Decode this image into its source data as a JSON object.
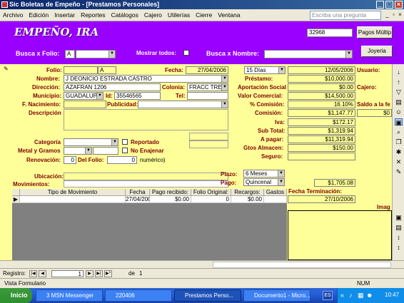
{
  "window": {
    "title": "Sic Boletas de Empeño - [Prestamos Personales]"
  },
  "menu": [
    "Archivo",
    "Edición",
    "Insertar",
    "Reportes",
    "Catálogos",
    "Cajero",
    "Utilerías",
    "Cierre",
    "Ventana"
  ],
  "help_placeholder": "Escriba una pregunta",
  "header": {
    "logo": "EMPEÑO, IRA",
    "number": "32968",
    "btn_pagos": "Pagos Múltip",
    "btn_joyeria": "Joyeria",
    "busca_folio_label": "Busca x Folio:",
    "busca_folio_value": "A",
    "mostrar_todos_label": "Mostrar todos:",
    "busca_nombre_label": "Busca x Nombre:"
  },
  "form": {
    "folio_label": "Folio:",
    "folio_prefix": "A",
    "fecha_label": "Fecha:",
    "fecha_value": "27/04/2006",
    "plazo_dias": "15 Días",
    "fecha2_value": "12/05/2006",
    "usuario_label": "Usuario:",
    "nombre_label": "Nombre:",
    "nombre_value": "J DEONICIO ESTRADA CASTRO",
    "direccion_label": "Dirección:",
    "direccion_value": "AZAFRAN 1206",
    "colonia_label": "Colonia:",
    "colonia_value": "FRACC TRES",
    "municipio_label": "Municipio:",
    "municipio_value": "GUADALUPE",
    "id_label": "Id:",
    "id_value": "35546565",
    "tel_label": "Tel:",
    "nacimiento_label": "F. Nacimiento:",
    "publicidad_label": "Publicidad:",
    "descripcion_label": "Descripción",
    "categoria_label": "Categoría",
    "reportado_label": "Reportado",
    "metal_label": "Metal y Gramos",
    "no_enajenar_label": "No Enajenar",
    "renovacion_label": "Renovación:",
    "renovacion_value": "0",
    "delfolio_label": "Del Folio:",
    "delfolio_value": "0",
    "numerico": "numérico)",
    "ubicacion_label": "Ubicación:",
    "movimientos_label": "Movimientos:",
    "plazo_label": "Plazo:",
    "plazo_value": "6 Meses",
    "pago_label": "Pago:",
    "pago_value": "Quincenal",
    "fecha_terminacion_label": "Fecha Terminación:",
    "fecha_terminacion_value": "27/10/2006",
    "extra_amount": "$1,705.08",
    "imagen_label": "Imag"
  },
  "money": {
    "prestamo_label": "Préstamo:",
    "prestamo": "$10,000.00",
    "aportacion_label": "Aportación Social",
    "aportacion": "$0.00",
    "cajero_label": "Cajero:",
    "valor_label": "Valor Comercial:",
    "valor": "$14,500.00",
    "comision_pct_label": "% Comisión:",
    "comision_pct": "16.10%",
    "saldo_label": "Saldo a la fe",
    "comision_label": "Comisión:",
    "comision": "$1,147.77",
    "saldo_partial": "$0",
    "iva_label": "Iva:",
    "iva": "$172.17",
    "subtotal_label": "Sub Total:",
    "subtotal": "$1,319.94",
    "apagar_label": "A pagar:",
    "apagar": "$11,319.94",
    "gtos_label": "Gtos Almacen:",
    "gtos": "$150.00",
    "seguro_label": "Seguro:"
  },
  "grid": {
    "headers": [
      "Tipo de Movimiento",
      "Fecha",
      "Pago recibido:",
      "Folio Original:",
      "Recargos:",
      "Gastos"
    ],
    "row": [
      "",
      "27/04/2006",
      "$0.00",
      "0",
      "$0.00",
      ""
    ]
  },
  "nav": {
    "label": "Registro:",
    "current": "1",
    "of": "de",
    "total": "1"
  },
  "status": {
    "left": "Vista Formulario",
    "num": "NUM"
  },
  "taskbar": {
    "start": "Inicio",
    "tasks": [
      "3 MSN Messenger",
      "220406",
      "Prestamos Perso...",
      "Documento1 - Micro..."
    ],
    "lang": "ES",
    "clock": "10:47"
  }
}
